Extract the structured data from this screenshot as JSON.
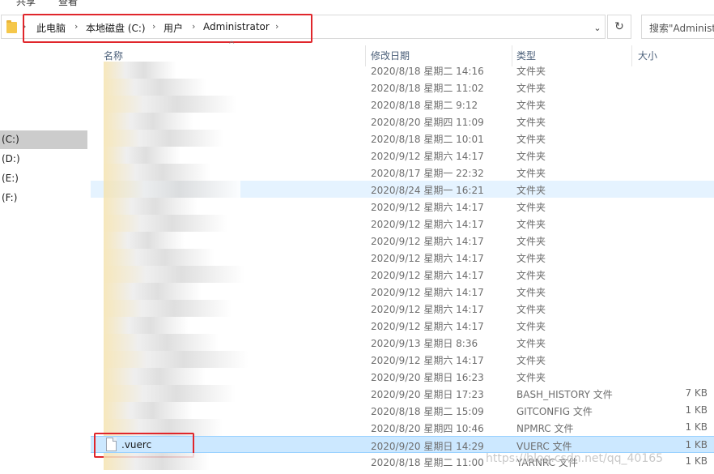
{
  "top_menu": [
    "共享",
    "查看"
  ],
  "address": {
    "crumbs": [
      "此电脑",
      "本地磁盘 (C:)",
      "用户",
      "Administrator"
    ],
    "dropdown_icon": "chevron-down-icon",
    "refresh_icon": "refresh-icon",
    "search_placeholder": "搜索\"Administ"
  },
  "nav": {
    "drives": [
      "(C:)",
      "(D:)",
      "(E:)",
      "(F:)"
    ],
    "selected": "(C:)"
  },
  "columns": {
    "name": "名称",
    "date": "修改日期",
    "type": "类型",
    "size": "大小"
  },
  "rows": [
    {
      "date": "2020/8/18 星期二 14:16",
      "type": "文件夹",
      "size": ""
    },
    {
      "date": "2020/8/18 星期二 11:02",
      "type": "文件夹",
      "size": ""
    },
    {
      "date": "2020/8/18 星期二 9:12",
      "type": "文件夹",
      "size": ""
    },
    {
      "date": "2020/8/20 星期四 11:09",
      "type": "文件夹",
      "size": ""
    },
    {
      "date": "2020/8/18 星期二 10:01",
      "type": "文件夹",
      "size": ""
    },
    {
      "date": "2020/9/12 星期六 14:17",
      "type": "文件夹",
      "size": ""
    },
    {
      "date": "2020/8/17 星期一 22:32",
      "type": "文件夹",
      "size": ""
    },
    {
      "date": "2020/8/24 星期一 16:21",
      "type": "文件夹",
      "size": ""
    },
    {
      "date": "2020/9/12 星期六 14:17",
      "type": "文件夹",
      "size": ""
    },
    {
      "date": "2020/9/12 星期六 14:17",
      "type": "文件夹",
      "size": ""
    },
    {
      "date": "2020/9/12 星期六 14:17",
      "type": "文件夹",
      "size": ""
    },
    {
      "date": "2020/9/12 星期六 14:17",
      "type": "文件夹",
      "size": ""
    },
    {
      "date": "2020/9/12 星期六 14:17",
      "type": "文件夹",
      "size": ""
    },
    {
      "date": "2020/9/12 星期六 14:17",
      "type": "文件夹",
      "size": ""
    },
    {
      "date": "2020/9/12 星期六 14:17",
      "type": "文件夹",
      "size": ""
    },
    {
      "date": "2020/9/12 星期六 14:17",
      "type": "文件夹",
      "size": ""
    },
    {
      "date": "2020/9/13 星期日 8:36",
      "type": "文件夹",
      "size": ""
    },
    {
      "date": "2020/9/12 星期六 14:17",
      "type": "文件夹",
      "size": ""
    },
    {
      "date": "2020/9/20 星期日 16:23",
      "type": "文件夹",
      "size": ""
    },
    {
      "date": "2020/9/20 星期日 17:23",
      "type": "BASH_HISTORY 文件",
      "size": "7 KB"
    },
    {
      "date": "2020/8/18 星期二 15:09",
      "type": "GITCONFIG 文件",
      "size": "1 KB"
    },
    {
      "date": "2020/8/20 星期四 10:46",
      "type": "NPMRC 文件",
      "size": "1 KB"
    },
    {
      "name": ".vuerc",
      "date": "2020/9/20 星期日 14:29",
      "type": "VUERC 文件",
      "size": "1 KB"
    },
    {
      "date": "2020/8/18 星期二 11:00",
      "type": "YARNRC 文件",
      "size": "1 KB"
    }
  ],
  "watermark": "https://blog.csdn.net/qq_40165"
}
